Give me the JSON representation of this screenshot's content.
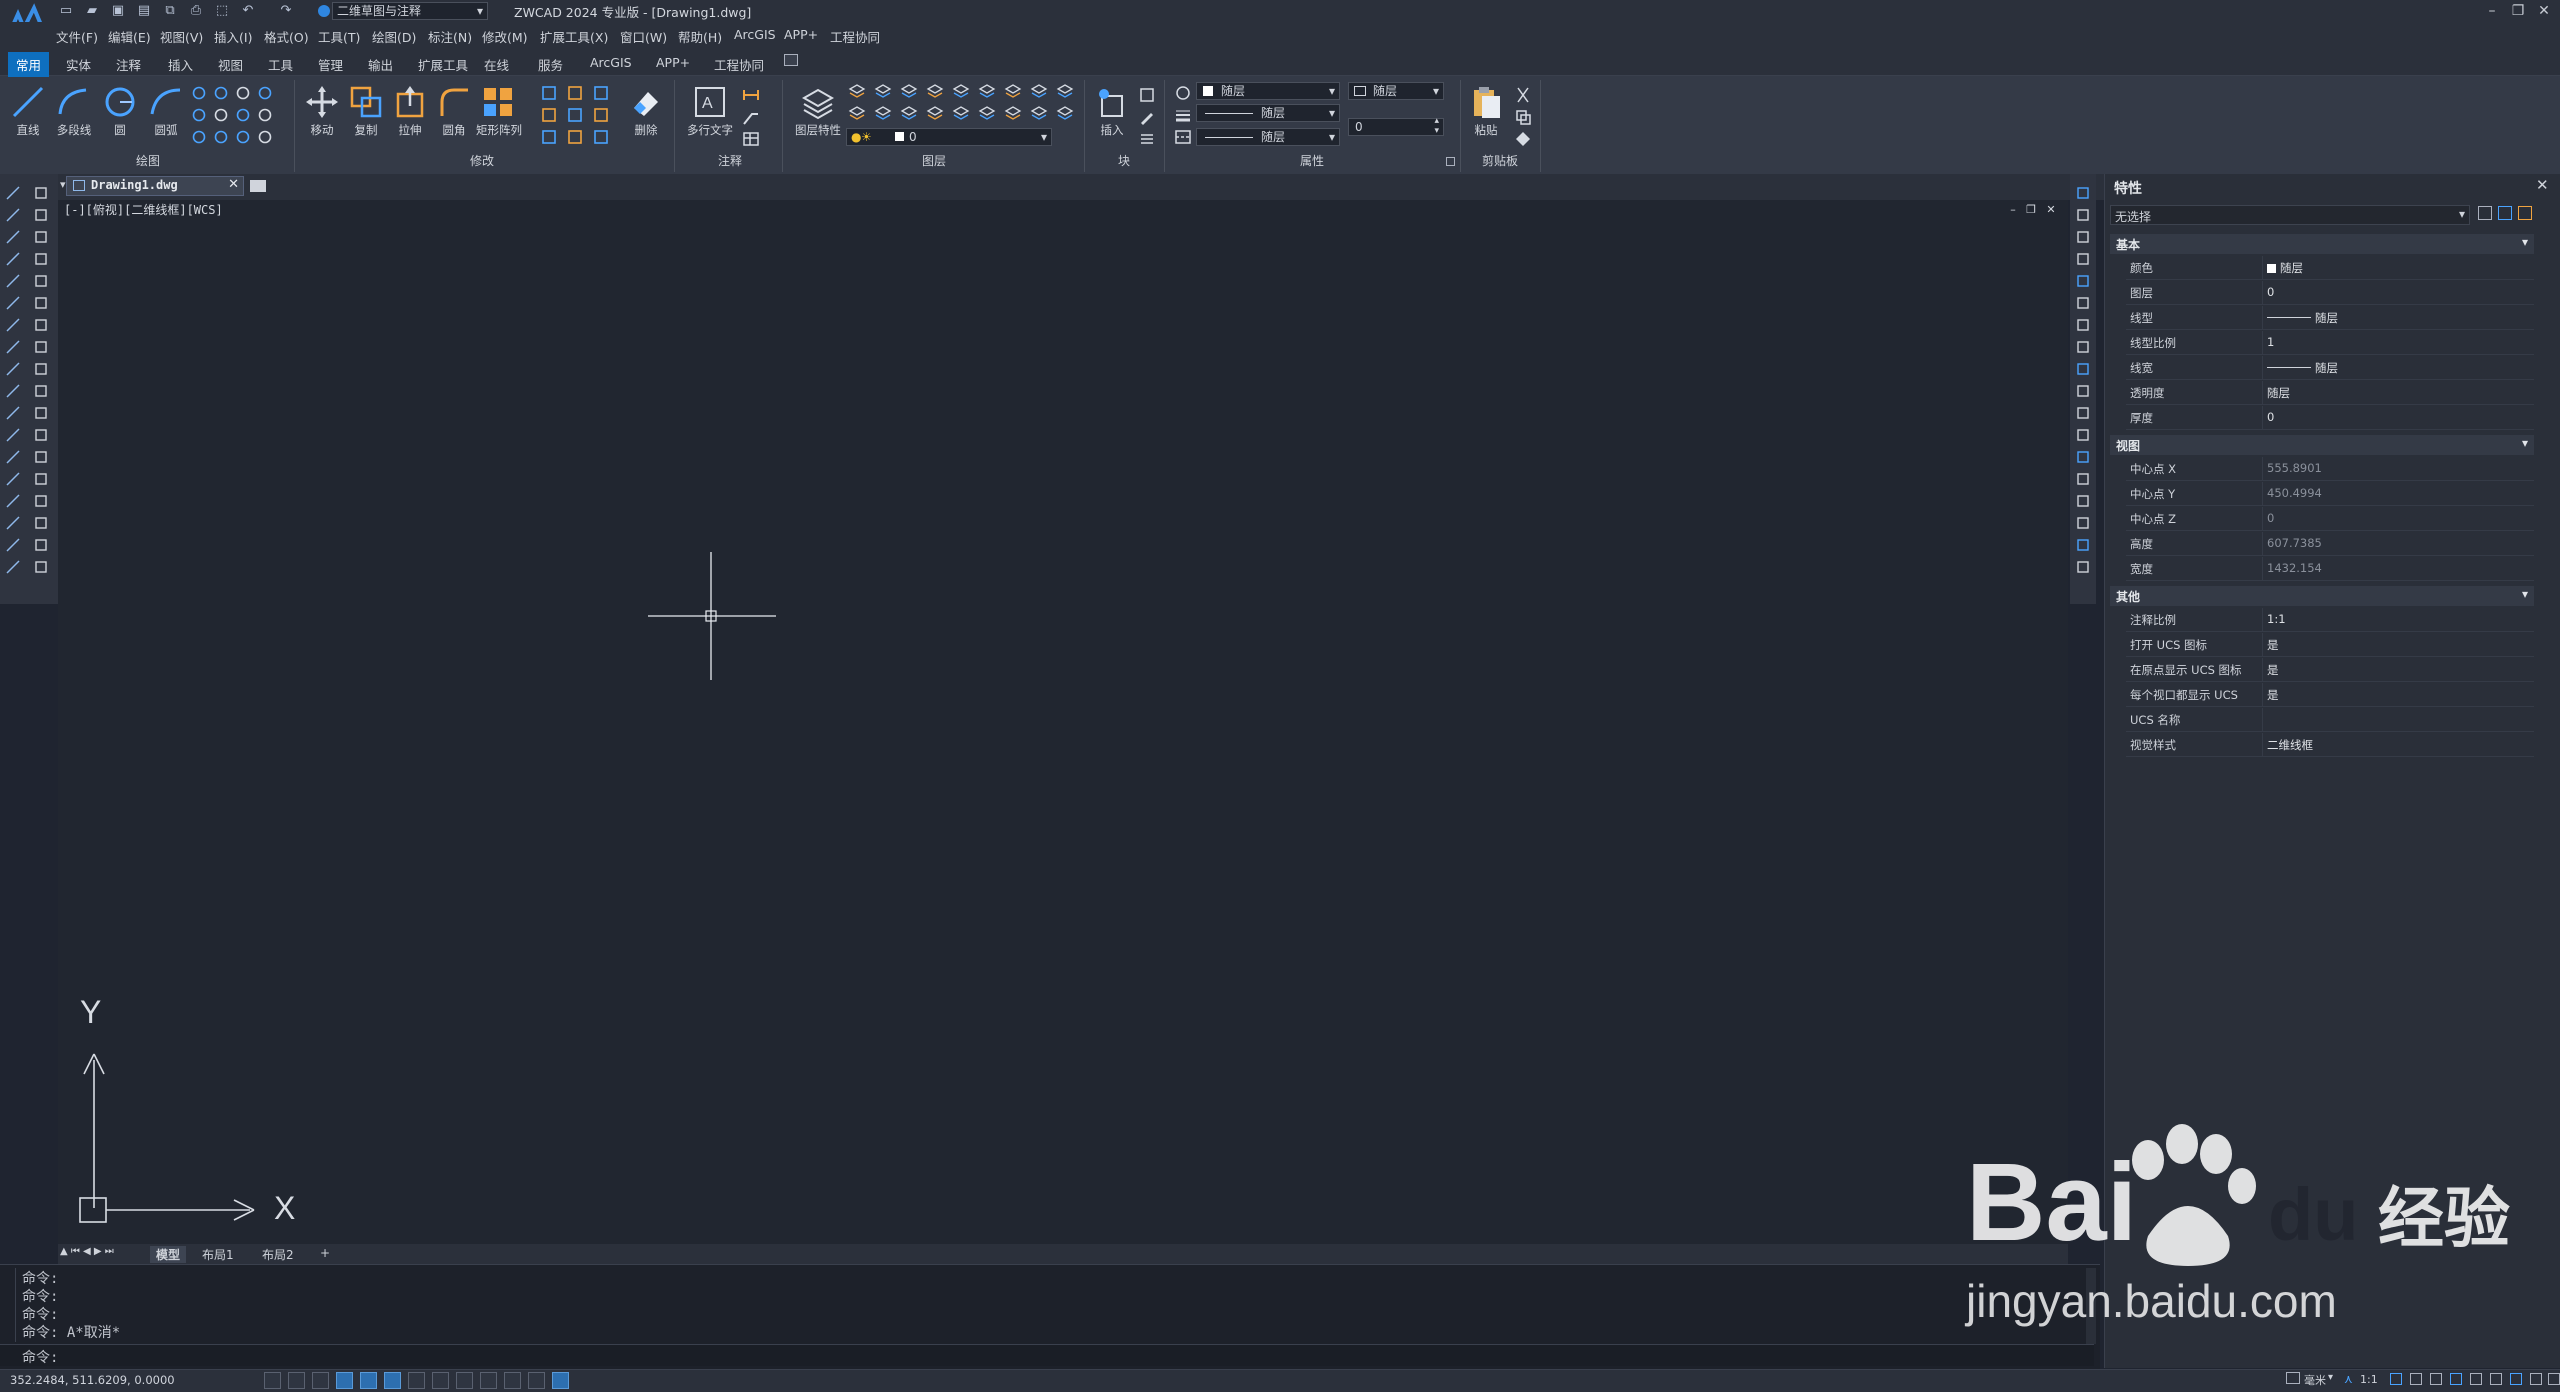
{
  "window": {
    "title": "ZWCAD 2024 专业版 - [Drawing1.dwg]",
    "workspace": "二维草图与注释"
  },
  "menu": [
    "文件(F)",
    "编辑(E)",
    "视图(V)",
    "插入(I)",
    "格式(O)",
    "工具(T)",
    "绘图(D)",
    "标注(N)",
    "修改(M)",
    "扩展工具(X)",
    "窗口(W)",
    "帮助(H)",
    "ArcGIS",
    "APP+",
    "工程协同"
  ],
  "tabs": [
    "常用",
    "实体",
    "注释",
    "插入",
    "视图",
    "工具",
    "管理",
    "输出",
    "扩展工具",
    "在线",
    "服务",
    "ArcGIS",
    "APP+",
    "工程协同"
  ],
  "ribbon": {
    "draw": {
      "group": "绘图",
      "buttons": [
        "直线",
        "多段线",
        "圆",
        "圆弧"
      ]
    },
    "modify": {
      "group": "修改",
      "buttons": [
        "移动",
        "复制",
        "拉伸",
        "圆角",
        "矩形阵列",
        "删除"
      ]
    },
    "annot": {
      "group": "注释",
      "buttons": [
        "多行文字"
      ]
    },
    "layer": {
      "group": "图层",
      "buttons": [
        "图层特性"
      ],
      "current_layer": "0"
    },
    "block": {
      "group": "块",
      "buttons": [
        "插入"
      ]
    },
    "props": {
      "group": "属性",
      "color": "随层",
      "linetype": "随层",
      "lineweight": "随层",
      "plotstyle": "随层",
      "transparency": "0"
    },
    "clip": {
      "group": "剪贴板",
      "buttons": [
        "粘贴"
      ]
    }
  },
  "document": {
    "tab": "Drawing1.dwg",
    "viewport_label": "[-][俯视][二维线框][WCS]",
    "ucs_x": "X",
    "ucs_y": "Y"
  },
  "layout_tabs": [
    "模型",
    "布局1",
    "布局2",
    "+"
  ],
  "command": {
    "history": [
      "命令:",
      "命令:",
      "命令:",
      "命令: A*取消*"
    ],
    "prompt": "命令:"
  },
  "status": {
    "coords": "352.2484, 511.6209, 0.0000",
    "units": "毫米",
    "scale": "1:1"
  },
  "properties": {
    "title": "特性",
    "selection": "无选择",
    "sections": [
      {
        "name": "基本",
        "rows": [
          {
            "k": "颜色",
            "v": "随层"
          },
          {
            "k": "图层",
            "v": "0"
          },
          {
            "k": "线型",
            "v": "随层"
          },
          {
            "k": "线型比例",
            "v": "1"
          },
          {
            "k": "线宽",
            "v": "随层"
          },
          {
            "k": "透明度",
            "v": "随层"
          },
          {
            "k": "厚度",
            "v": "0"
          }
        ]
      },
      {
        "name": "视图",
        "rows": [
          {
            "k": "中心点 X",
            "v": "555.8901"
          },
          {
            "k": "中心点 Y",
            "v": "450.4994"
          },
          {
            "k": "中心点 Z",
            "v": "0"
          },
          {
            "k": "高度",
            "v": "607.7385"
          },
          {
            "k": "宽度",
            "v": "1432.154"
          }
        ]
      },
      {
        "name": "其他",
        "rows": [
          {
            "k": "注释比例",
            "v": "1:1"
          },
          {
            "k": "打开 UCS 图标",
            "v": "是"
          },
          {
            "k": "在原点显示 UCS 图标",
            "v": "是"
          },
          {
            "k": "每个视口都显示 UCS",
            "v": "是"
          },
          {
            "k": "UCS 名称",
            "v": ""
          },
          {
            "k": "视觉样式",
            "v": "二维线框"
          }
        ]
      }
    ]
  },
  "watermark": {
    "brand": "Bai",
    "brand2": "du",
    "cn": "经验",
    "url": "jingyan.baidu.com"
  },
  "colors": {
    "accent": "#0e6fbf",
    "canvas": "#212630",
    "panel": "#2a2f39"
  }
}
